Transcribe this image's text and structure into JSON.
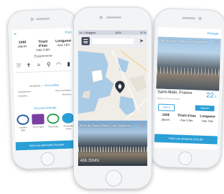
{
  "colors": {
    "accent": "#2a9fd6",
    "heart": "#e84a6a",
    "menu_button": "#4b5260",
    "map_water": "#a9cbe6",
    "map_land": "#f0ede6"
  },
  "left_screen": {
    "close": "✕",
    "nav": "Port",
    "stats": [
      {
        "value": "1200",
        "label": "places"
      },
      {
        "value": "Tirant d'eau",
        "label": "max 2,8m"
      },
      {
        "value": "Longueur",
        "label": "max 13m"
      }
    ],
    "equipements_title": "Équipements",
    "equipements_icons": [
      "shower-icon",
      "person-icon",
      "swimmer-icon",
      "restroom-icon",
      "wifi-icon",
      "fuel-icon"
    ],
    "horaires": "Horaires",
    "avant_after": "Accueil/Bar",
    "capitainerie": "Capitainerie",
    "capitainerie_value": "Horaires",
    "port_label": "Port technique",
    "port_value": "Horaires",
    "eco_title": "Port eco-friendly",
    "badges": [
      {
        "name": "pavillon-bleu",
        "label": "Pavillon Bleu",
        "color": "#1f5aa6"
      },
      {
        "name": "ports-propres",
        "label": "Port Propre",
        "color": "#7b3fa1"
      },
      {
        "name": "recyclage",
        "label": "Recyclage",
        "color": "#2e9e4f"
      },
      {
        "name": "economie-eau",
        "label": "Economie d'eau",
        "color": "#2a9fd6"
      }
    ],
    "cta": "Faire une demande d'escale"
  },
  "center_screen": {
    "status": {
      "carrier": "•••○○ Bouygues",
      "time": "18:34",
      "battery": "87 %"
    },
    "map_labels": [
      "Saint-Malo",
      "Dinard"
    ],
    "photo_caption": "Port de Saint-Malo - Les Sablons",
    "distance": "486.39MN"
  },
  "right_screen": {
    "share": "Partager",
    "photo_caption": "Port de Saint-Malo - Les Sablons",
    "city": "Saint-Malo, France",
    "temperature": "22",
    "temp_unit": "°C",
    "subtext": "Météo | Fiche du port",
    "verif_label": "VHF 9",
    "appeler_label": "Appeler",
    "stats": [
      {
        "value": "1200",
        "label": "places"
      },
      {
        "value": "Tirant d'eau",
        "label": "max 2,8m"
      },
      {
        "value": "Longueur",
        "label": "max 13m"
      }
    ],
    "cta": "Faire une demande d'escale"
  }
}
